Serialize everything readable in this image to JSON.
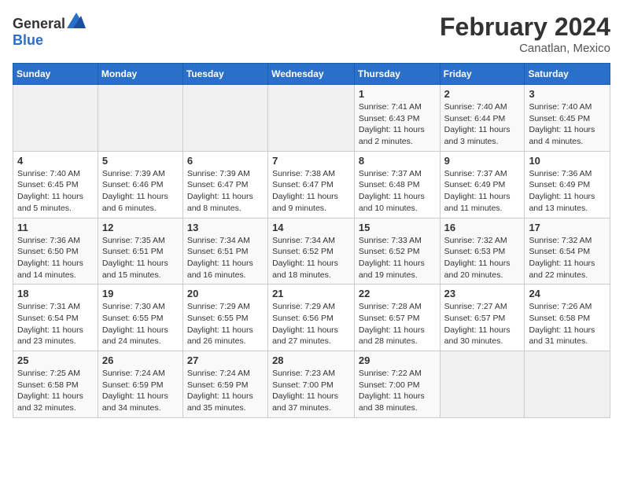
{
  "header": {
    "logo_general": "General",
    "logo_blue": "Blue",
    "title": "February 2024",
    "subtitle": "Canatlan, Mexico"
  },
  "days_of_week": [
    "Sunday",
    "Monday",
    "Tuesday",
    "Wednesday",
    "Thursday",
    "Friday",
    "Saturday"
  ],
  "weeks": [
    [
      {
        "num": "",
        "info": ""
      },
      {
        "num": "",
        "info": ""
      },
      {
        "num": "",
        "info": ""
      },
      {
        "num": "",
        "info": ""
      },
      {
        "num": "1",
        "info": "Sunrise: 7:41 AM\nSunset: 6:43 PM\nDaylight: 11 hours and 2 minutes."
      },
      {
        "num": "2",
        "info": "Sunrise: 7:40 AM\nSunset: 6:44 PM\nDaylight: 11 hours and 3 minutes."
      },
      {
        "num": "3",
        "info": "Sunrise: 7:40 AM\nSunset: 6:45 PM\nDaylight: 11 hours and 4 minutes."
      }
    ],
    [
      {
        "num": "4",
        "info": "Sunrise: 7:40 AM\nSunset: 6:45 PM\nDaylight: 11 hours and 5 minutes."
      },
      {
        "num": "5",
        "info": "Sunrise: 7:39 AM\nSunset: 6:46 PM\nDaylight: 11 hours and 6 minutes."
      },
      {
        "num": "6",
        "info": "Sunrise: 7:39 AM\nSunset: 6:47 PM\nDaylight: 11 hours and 8 minutes."
      },
      {
        "num": "7",
        "info": "Sunrise: 7:38 AM\nSunset: 6:47 PM\nDaylight: 11 hours and 9 minutes."
      },
      {
        "num": "8",
        "info": "Sunrise: 7:37 AM\nSunset: 6:48 PM\nDaylight: 11 hours and 10 minutes."
      },
      {
        "num": "9",
        "info": "Sunrise: 7:37 AM\nSunset: 6:49 PM\nDaylight: 11 hours and 11 minutes."
      },
      {
        "num": "10",
        "info": "Sunrise: 7:36 AM\nSunset: 6:49 PM\nDaylight: 11 hours and 13 minutes."
      }
    ],
    [
      {
        "num": "11",
        "info": "Sunrise: 7:36 AM\nSunset: 6:50 PM\nDaylight: 11 hours and 14 minutes."
      },
      {
        "num": "12",
        "info": "Sunrise: 7:35 AM\nSunset: 6:51 PM\nDaylight: 11 hours and 15 minutes."
      },
      {
        "num": "13",
        "info": "Sunrise: 7:34 AM\nSunset: 6:51 PM\nDaylight: 11 hours and 16 minutes."
      },
      {
        "num": "14",
        "info": "Sunrise: 7:34 AM\nSunset: 6:52 PM\nDaylight: 11 hours and 18 minutes."
      },
      {
        "num": "15",
        "info": "Sunrise: 7:33 AM\nSunset: 6:52 PM\nDaylight: 11 hours and 19 minutes."
      },
      {
        "num": "16",
        "info": "Sunrise: 7:32 AM\nSunset: 6:53 PM\nDaylight: 11 hours and 20 minutes."
      },
      {
        "num": "17",
        "info": "Sunrise: 7:32 AM\nSunset: 6:54 PM\nDaylight: 11 hours and 22 minutes."
      }
    ],
    [
      {
        "num": "18",
        "info": "Sunrise: 7:31 AM\nSunset: 6:54 PM\nDaylight: 11 hours and 23 minutes."
      },
      {
        "num": "19",
        "info": "Sunrise: 7:30 AM\nSunset: 6:55 PM\nDaylight: 11 hours and 24 minutes."
      },
      {
        "num": "20",
        "info": "Sunrise: 7:29 AM\nSunset: 6:55 PM\nDaylight: 11 hours and 26 minutes."
      },
      {
        "num": "21",
        "info": "Sunrise: 7:29 AM\nSunset: 6:56 PM\nDaylight: 11 hours and 27 minutes."
      },
      {
        "num": "22",
        "info": "Sunrise: 7:28 AM\nSunset: 6:57 PM\nDaylight: 11 hours and 28 minutes."
      },
      {
        "num": "23",
        "info": "Sunrise: 7:27 AM\nSunset: 6:57 PM\nDaylight: 11 hours and 30 minutes."
      },
      {
        "num": "24",
        "info": "Sunrise: 7:26 AM\nSunset: 6:58 PM\nDaylight: 11 hours and 31 minutes."
      }
    ],
    [
      {
        "num": "25",
        "info": "Sunrise: 7:25 AM\nSunset: 6:58 PM\nDaylight: 11 hours and 32 minutes."
      },
      {
        "num": "26",
        "info": "Sunrise: 7:24 AM\nSunset: 6:59 PM\nDaylight: 11 hours and 34 minutes."
      },
      {
        "num": "27",
        "info": "Sunrise: 7:24 AM\nSunset: 6:59 PM\nDaylight: 11 hours and 35 minutes."
      },
      {
        "num": "28",
        "info": "Sunrise: 7:23 AM\nSunset: 7:00 PM\nDaylight: 11 hours and 37 minutes."
      },
      {
        "num": "29",
        "info": "Sunrise: 7:22 AM\nSunset: 7:00 PM\nDaylight: 11 hours and 38 minutes."
      },
      {
        "num": "",
        "info": ""
      },
      {
        "num": "",
        "info": ""
      }
    ]
  ]
}
